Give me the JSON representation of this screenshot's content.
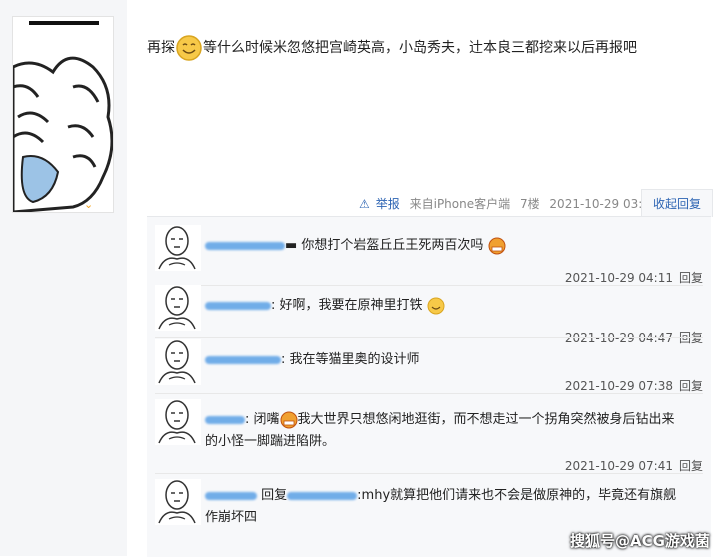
{
  "post": {
    "text_before": "再探",
    "text_after": "等什么时候米忽悠把宫崎英高，小岛秀夫，辻本良三都挖来以后再报吧"
  },
  "meta": {
    "report": "举报",
    "source": "来自iPhone客户端",
    "floor": "7楼",
    "time": "2021-10-29 03:09",
    "collapse": "收起回复"
  },
  "replies": [
    {
      "text": "你想打个岩盔丘丘王死两百次吗",
      "time": "2021-10-29 04:11",
      "reply_label": "回复"
    },
    {
      "text": "好啊，我要在原神里打铁",
      "time": "2021-10-29 04:47",
      "reply_label": "回复"
    },
    {
      "text": "我在等猫里奥的设计师",
      "time": "2021-10-29 07:38",
      "reply_label": "回复"
    },
    {
      "prefix": ": 闭嘴",
      "text": "我大世界只想悠闲地逛街，而不想走过一个拐角突然被身后钻出来",
      "text2": "的小怪一脚踹进陷阱。",
      "time": "2021-10-29 07:41",
      "reply_label": "回复"
    },
    {
      "prefix": "回复",
      "text": ":mhy就算把他们请来也不会是做原神的，毕竟还有旗舰",
      "text2": "作崩坏四"
    }
  ],
  "watermark": "搜狐号@ACG游戏菌",
  "colors": {
    "link": "#2d64b3",
    "reply_bg": "#f7f8fa",
    "redacted": "#5aa0e6"
  }
}
